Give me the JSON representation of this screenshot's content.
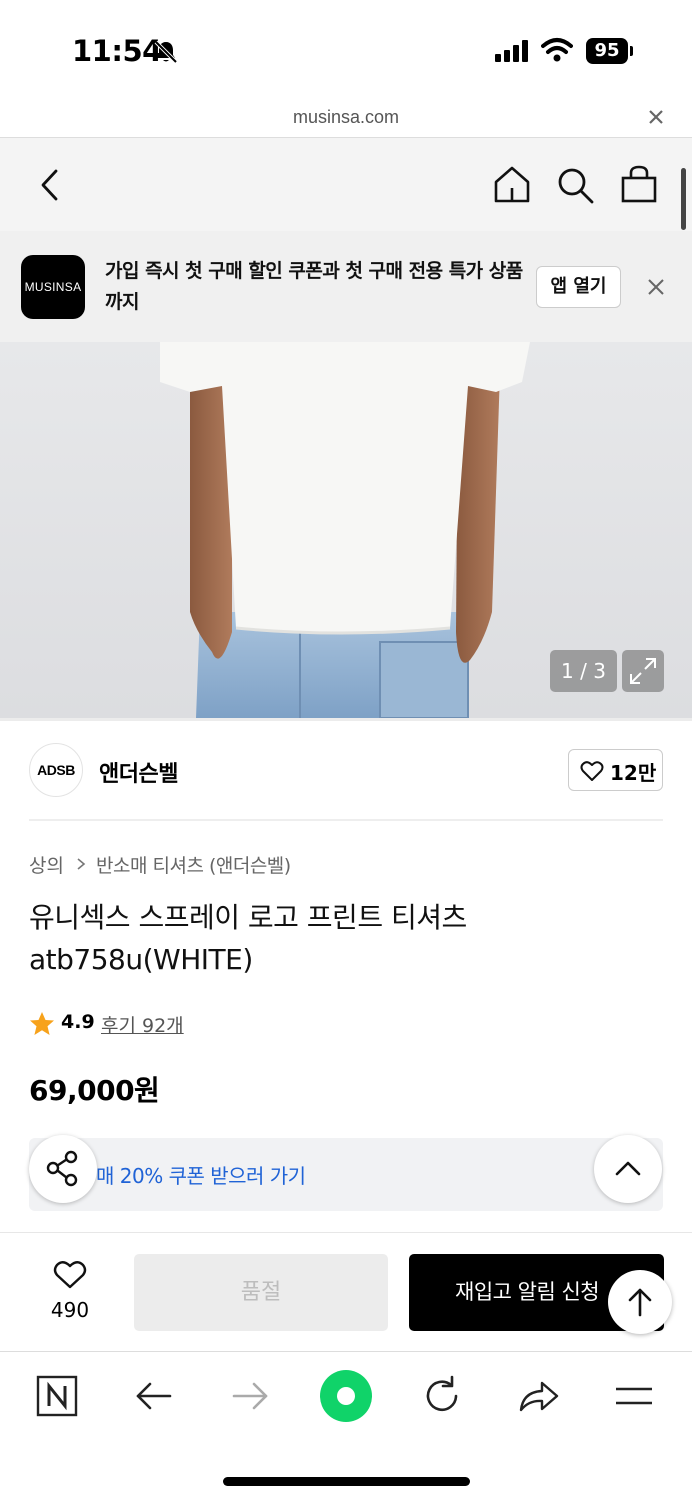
{
  "status_bar": {
    "time": "11:54",
    "battery": "95"
  },
  "browser": {
    "url": "musinsa.com"
  },
  "app_banner": {
    "logo_text": "MUSINSA",
    "message": "가입 즉시 첫 구매 할인 쿠폰과 첫 구매 전용 특가 상품까지",
    "open_app_label": "앱 열기"
  },
  "gallery": {
    "counter": "1 / 3"
  },
  "brand": {
    "logo_text": "ADSB",
    "name": "앤더슨벨",
    "like_count": "12만"
  },
  "breadcrumb": {
    "category": "상의",
    "subcategory": "반소매 티셔츠 (앤더슨벨)"
  },
  "product": {
    "title": "유니섹스 스프레이 로고 프린트 티셔츠 atb758u(WHITE)",
    "rating": "4.9",
    "review_link": "후기 92개",
    "price": "69,000원"
  },
  "coupon": {
    "text": "매 20% 쿠폰 받으러 가기"
  },
  "purchase_bar": {
    "wish_count": "490",
    "soldout_label": "품절",
    "restock_label": "재입고 알림 신청"
  },
  "colors": {
    "accent_blue": "#2063d6",
    "primary_black": "#000000",
    "disabled_gray": "#ececec",
    "star_orange": "#f7a21b"
  },
  "icons": [
    "bell-slash-icon",
    "signal-icon",
    "wifi-icon",
    "close-icon",
    "back-icon",
    "home-icon",
    "search-icon",
    "shopping-bag-icon",
    "expand-icon",
    "heart-icon",
    "chevron-right-icon",
    "star-icon",
    "share-icon",
    "chevron-up-icon",
    "arrow-up-icon",
    "naver-logo-icon",
    "arrow-left-icon",
    "arrow-right-icon",
    "green-dot-icon",
    "refresh-icon",
    "share-arrow-icon",
    "menu-icon"
  ]
}
